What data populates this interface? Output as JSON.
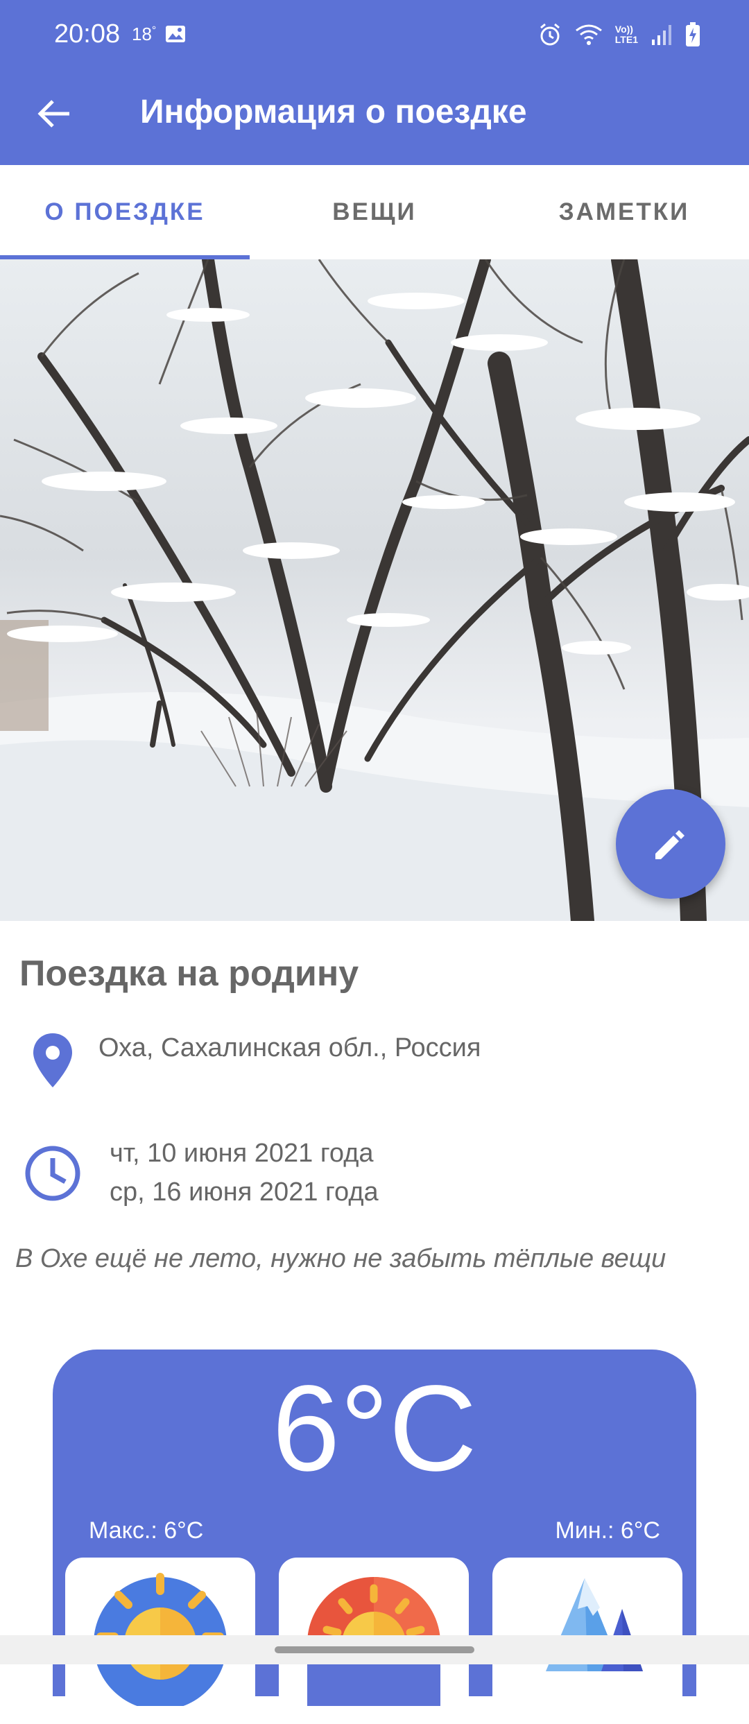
{
  "status_bar": {
    "time": "20:08",
    "temperature": "18",
    "temperature_unit": "°",
    "network_label_top": "Vo))",
    "network_label_bottom": "LTE1",
    "icons": [
      "image-icon",
      "alarm-icon",
      "wifi-icon",
      "signal-icon",
      "battery-charging-icon"
    ]
  },
  "toolbar": {
    "title": "Информация о поездке",
    "back_icon": "arrow-back-icon"
  },
  "tabs": [
    {
      "label": "О ПОЕЗДКЕ",
      "active": true
    },
    {
      "label": "ВЕЩИ",
      "active": false
    },
    {
      "label": "ЗАМЕТКИ",
      "active": false
    }
  ],
  "hero": {
    "fab_icon": "edit-pencil-icon"
  },
  "trip": {
    "title": "Поездка на родину",
    "location": "Оха, Сахалинская обл., Россия",
    "date_start": "чт, 10 июня 2021 года",
    "date_end": "ср, 16 июня 2021 года",
    "note": "В Охе ещё не лето, нужно не забыть тёплые вещи"
  },
  "weather": {
    "temperature": "6°C",
    "max": "Макс.: 6°C",
    "min": "Мин.: 6°C",
    "cards": [
      "sun-icon",
      "sunset-icon",
      "mountains-icon"
    ]
  },
  "colors": {
    "accent": "#5c72d6",
    "text_secondary": "#666666",
    "background": "#ffffff"
  }
}
